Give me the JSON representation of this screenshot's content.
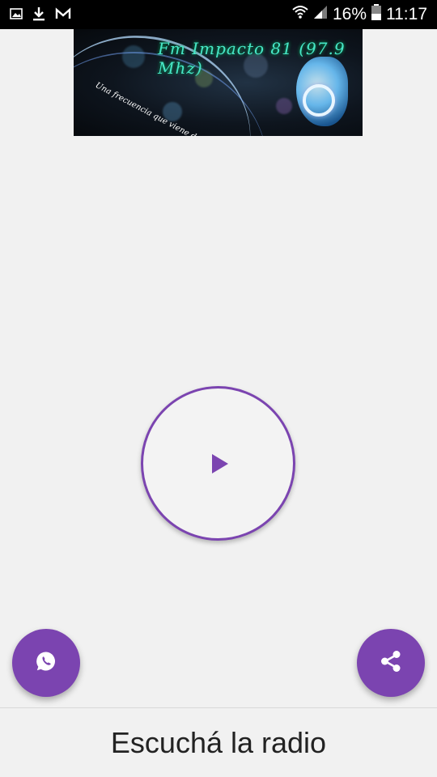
{
  "status_bar": {
    "icons_left": [
      "image-icon",
      "download-icon",
      "gmail-icon"
    ],
    "icons_right": [
      "wifi-icon",
      "signal-icon",
      "battery-icon"
    ],
    "battery": "16%",
    "time": "11:17"
  },
  "banner": {
    "title": "Fm Impacto 81 (97.9 Mhz)",
    "slogan": "Una frecuencia que viene de lo alto"
  },
  "player": {
    "play_icon": "play-icon",
    "accent_color": "#7b44b0"
  },
  "fabs": {
    "whatsapp_icon": "whatsapp-icon",
    "share_icon": "share-icon"
  },
  "bottom": {
    "label": "Escuchá la radio"
  }
}
